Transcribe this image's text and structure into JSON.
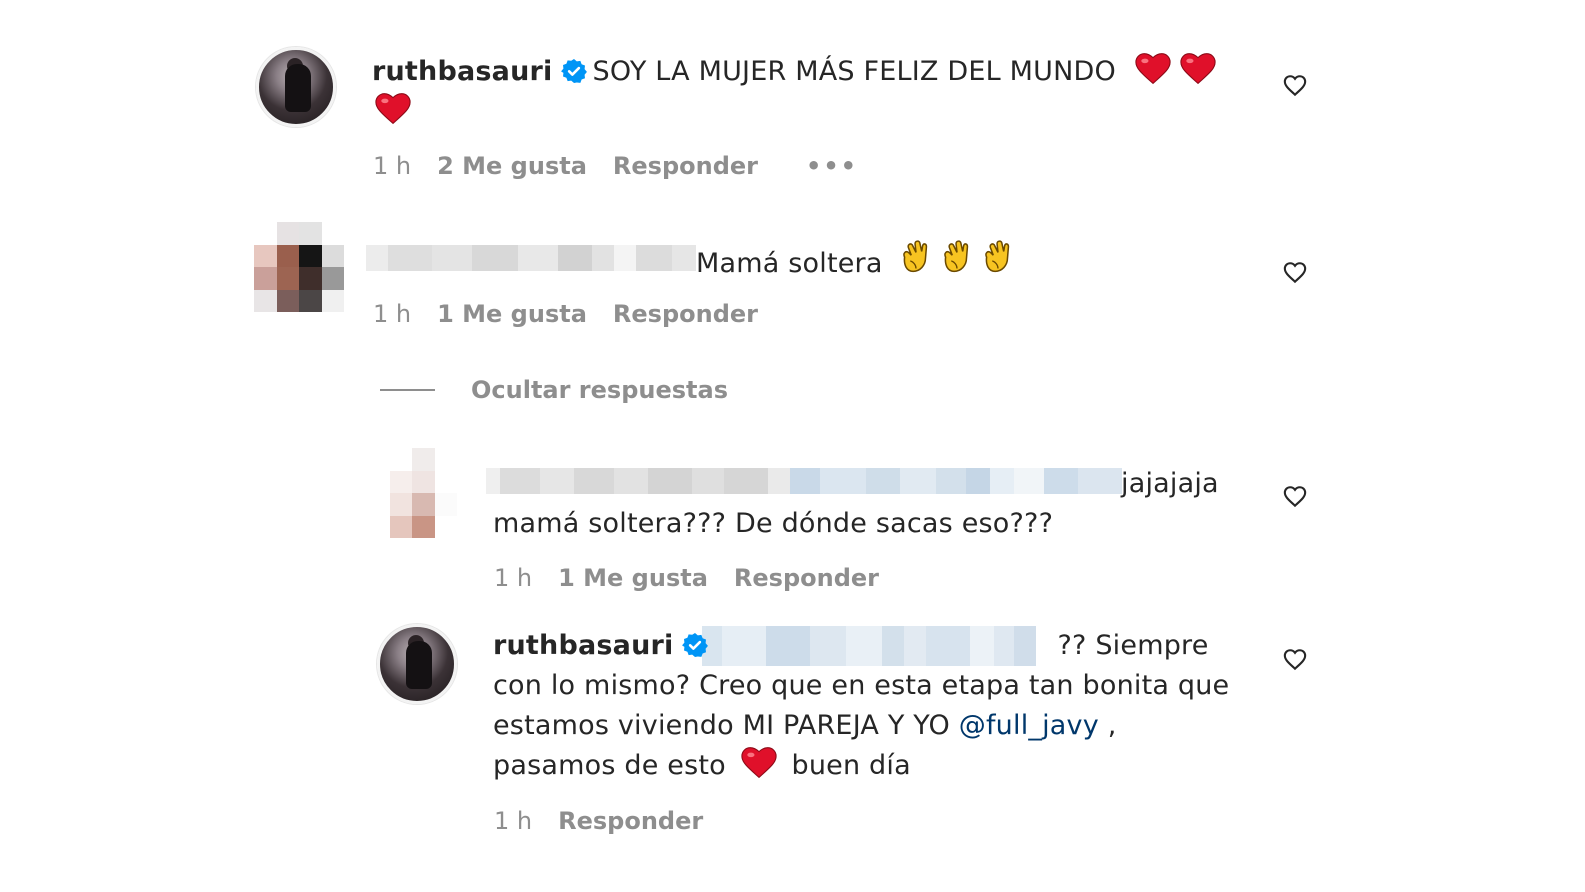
{
  "icons": {
    "verified": "verified-badge-icon",
    "like": "heart-outline-icon",
    "red_heart": "red-heart-emoji",
    "clap": "clapping-hands-emoji",
    "more": "more-options-icon"
  },
  "colors": {
    "verified_blue": "#0095f6",
    "meta_gray": "#8e8e8e",
    "mention_blue": "#00376b",
    "emoji_red": "#e0102a",
    "clap_yellow": "#f7c421"
  },
  "comments": [
    {
      "username": "ruthbasauri",
      "text": "SOY LA MUJER MÁS FELIZ DEL MUNDO",
      "time": "1 h",
      "likes": "2 Me gusta",
      "reply": "Responder",
      "more": "•••"
    },
    {
      "text": "Mamá soltera",
      "time": "1 h",
      "likes": "1 Me gusta",
      "reply": "Responder"
    }
  ],
  "hide_replies_label": "Ocultar respuestas",
  "replies": [
    {
      "text_line1": "jajajaja",
      "text_line2": "mamá soltera??? De dónde sacas eso???",
      "time": "1 h",
      "likes": "1 Me gusta",
      "reply": "Responder"
    },
    {
      "username": "ruthbasauri",
      "text_line1": "?? Siempre",
      "text_line2": "con lo mismo? Creo que en esta etapa tan bonita que",
      "text_line3": "estamos viviendo MI PAREJA Y YO",
      "mention": "@full_javy",
      "text_line3_end": ",",
      "text_line4_a": "pasamos de esto",
      "text_line4_b": "buen día",
      "time": "1 h",
      "reply": "Responder"
    }
  ]
}
